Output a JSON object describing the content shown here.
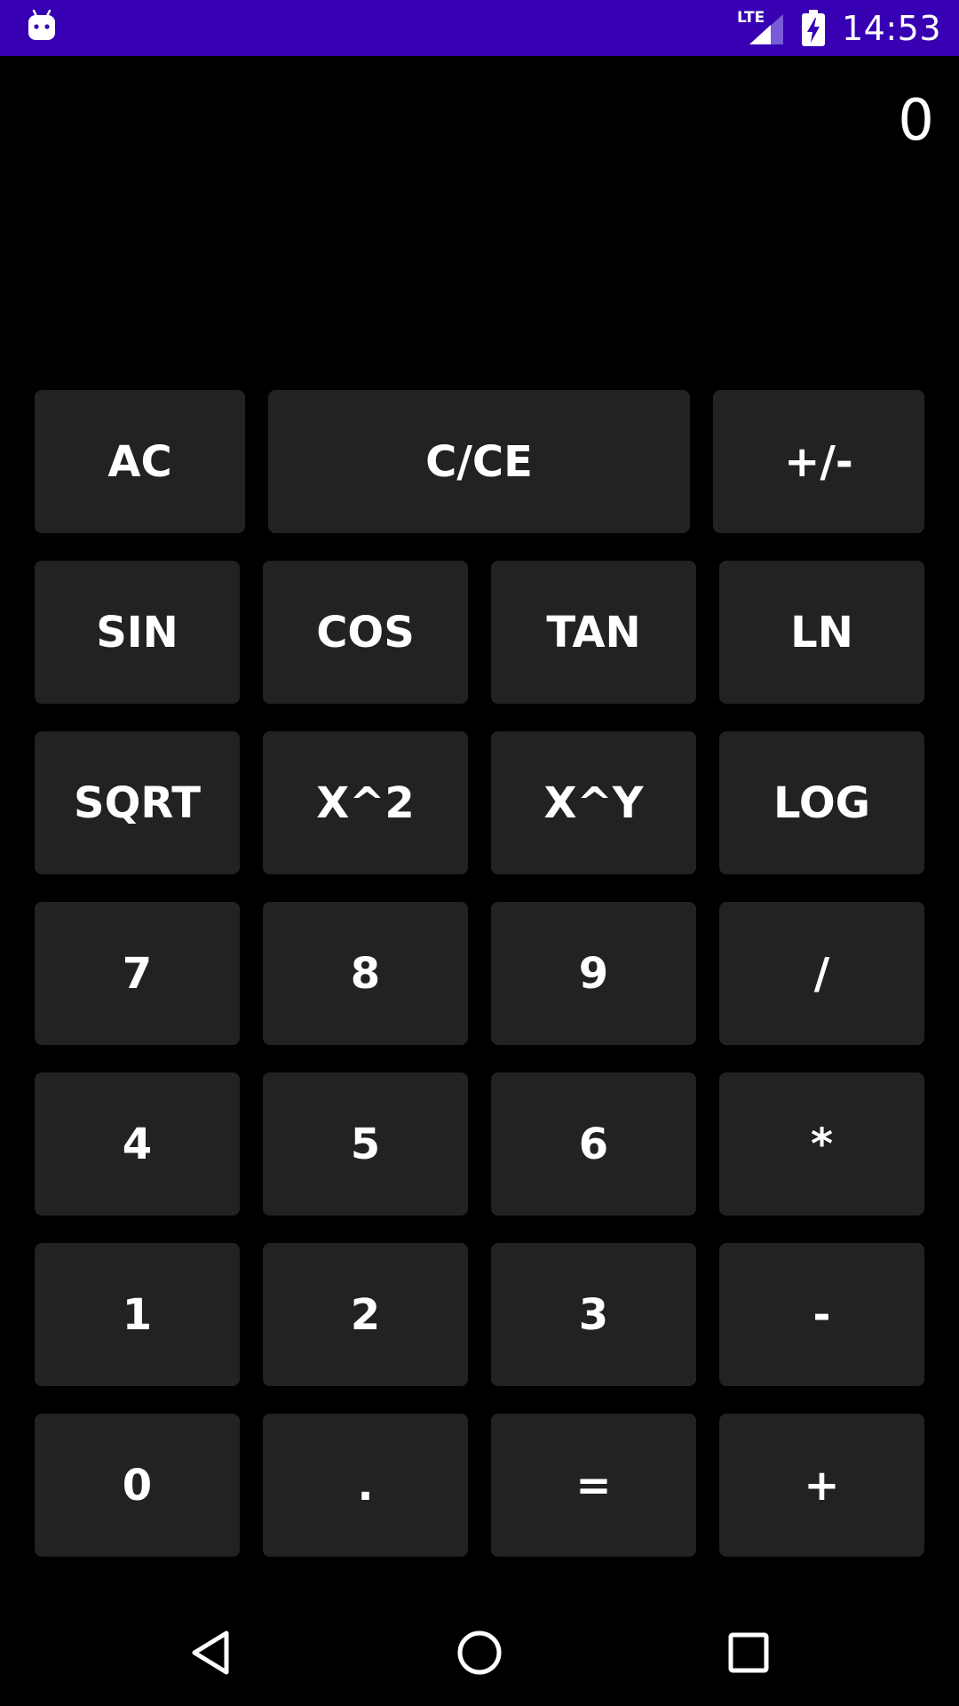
{
  "status_bar": {
    "network": "LTE",
    "time": "14:53",
    "icons": [
      "android-icon",
      "signal-icon",
      "battery-charging-icon"
    ],
    "background": "#3700b3"
  },
  "display": {
    "value": "0"
  },
  "keypad": {
    "row1": [
      "AC",
      "C/CE",
      "+/-"
    ],
    "row2": [
      "SIN",
      "COS",
      "TAN",
      "LN"
    ],
    "row3": [
      "SQRT",
      "X^2",
      "X^Y",
      "LOG"
    ],
    "row4": [
      "7",
      "8",
      "9",
      "/"
    ],
    "row5": [
      "4",
      "5",
      "6",
      "*"
    ],
    "row6": [
      "1",
      "2",
      "3",
      "-"
    ],
    "row7": [
      "0",
      ".",
      "=",
      "+"
    ],
    "key_color": "#222222"
  },
  "nav_bar": {
    "icons": [
      "back-icon",
      "home-icon",
      "recents-icon"
    ]
  }
}
